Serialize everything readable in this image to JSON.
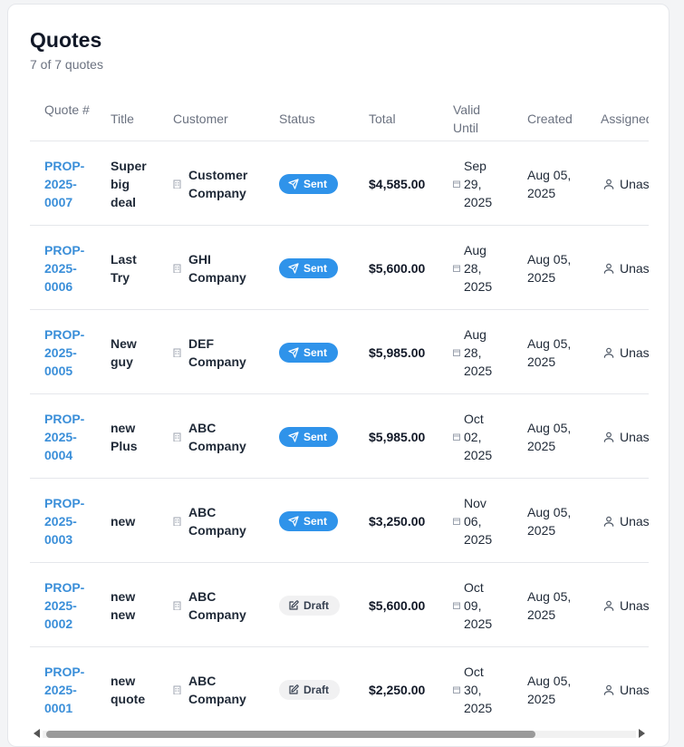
{
  "page": {
    "title": "Quotes",
    "subtitle": "7 of 7 quotes"
  },
  "columns": {
    "quote_num": "Quote #",
    "title": "Title",
    "customer": "Customer",
    "status": "Status",
    "total": "Total",
    "valid_until": "Valid Until",
    "created": "Created",
    "assigned": "Assigned"
  },
  "rows": [
    {
      "quote": [
        "PROP-",
        "2025-",
        "0007"
      ],
      "title": [
        "Super",
        "big",
        "deal"
      ],
      "customer": [
        "Customer",
        "Company"
      ],
      "status": "Sent",
      "total": "$4,585.00",
      "valid": [
        "Sep",
        "29,",
        "2025"
      ],
      "created": [
        "Aug 05,",
        "2025"
      ],
      "assigned": "Unassigned"
    },
    {
      "quote": [
        "PROP-",
        "2025-",
        "0006"
      ],
      "title": [
        "Last",
        "Try"
      ],
      "customer": [
        "GHI",
        "Company"
      ],
      "status": "Sent",
      "total": "$5,600.00",
      "valid": [
        "Aug",
        "28,",
        "2025"
      ],
      "created": [
        "Aug 05,",
        "2025"
      ],
      "assigned": "Unassigned"
    },
    {
      "quote": [
        "PROP-",
        "2025-",
        "0005"
      ],
      "title": [
        "New",
        "guy"
      ],
      "customer": [
        "DEF",
        "Company"
      ],
      "status": "Sent",
      "total": "$5,985.00",
      "valid": [
        "Aug",
        "28,",
        "2025"
      ],
      "created": [
        "Aug 05,",
        "2025"
      ],
      "assigned": "Unassigned"
    },
    {
      "quote": [
        "PROP-",
        "2025-",
        "0004"
      ],
      "title": [
        "new",
        "Plus"
      ],
      "customer": [
        "ABC",
        "Company"
      ],
      "status": "Sent",
      "total": "$5,985.00",
      "valid": [
        "Oct",
        "02,",
        "2025"
      ],
      "created": [
        "Aug 05,",
        "2025"
      ],
      "assigned": "Unassigned"
    },
    {
      "quote": [
        "PROP-",
        "2025-",
        "0003"
      ],
      "title": [
        "new"
      ],
      "customer": [
        "ABC",
        "Company"
      ],
      "status": "Sent",
      "total": "$3,250.00",
      "valid": [
        "Nov",
        "06,",
        "2025"
      ],
      "created": [
        "Aug 05,",
        "2025"
      ],
      "assigned": "Unassigned"
    },
    {
      "quote": [
        "PROP-",
        "2025-",
        "0002"
      ],
      "title": [
        "new",
        "new"
      ],
      "customer": [
        "ABC",
        "Company"
      ],
      "status": "Draft",
      "total": "$5,600.00",
      "valid": [
        "Oct",
        "09,",
        "2025"
      ],
      "created": [
        "Aug 05,",
        "2025"
      ],
      "assigned": "Unassigned"
    },
    {
      "quote": [
        "PROP-",
        "2025-",
        "0001"
      ],
      "title": [
        "new",
        "quote"
      ],
      "customer": [
        "ABC",
        "Company"
      ],
      "status": "Draft",
      "total": "$2,250.00",
      "valid": [
        "Oct",
        "30,",
        "2025"
      ],
      "created": [
        "Aug 05,",
        "2025"
      ],
      "assigned": "Unassigned"
    }
  ],
  "colors": {
    "link": "#3b8fd9",
    "sent": "#2f93ea",
    "draft_bg": "#f1f1f2"
  },
  "icons": {
    "status_sent": "send-icon",
    "status_draft": "edit-icon",
    "customer": "building-icon",
    "date": "calendar-icon",
    "assignee": "user-icon"
  }
}
